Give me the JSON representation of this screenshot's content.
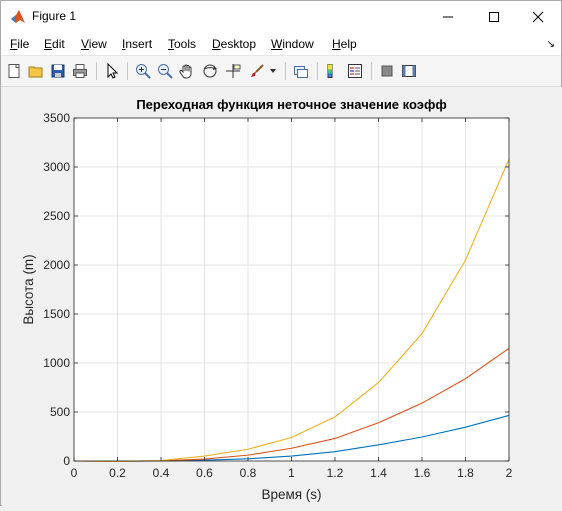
{
  "window": {
    "title": "Figure 1"
  },
  "menu": [
    {
      "pre": "",
      "u": "F",
      "post": "ile"
    },
    {
      "pre": "",
      "u": "E",
      "post": "dit"
    },
    {
      "pre": "",
      "u": "V",
      "post": "iew"
    },
    {
      "pre": "",
      "u": "I",
      "post": "nsert"
    },
    {
      "pre": "",
      "u": "T",
      "post": "ools"
    },
    {
      "pre": "",
      "u": "D",
      "post": "esktop"
    },
    {
      "pre": "",
      "u": "W",
      "post": "indow"
    },
    {
      "pre": "",
      "u": "H",
      "post": "elp"
    }
  ],
  "toolbar": [
    "new-figure-icon",
    "open-file-icon",
    "save-icon",
    "print-icon",
    "pointer-icon",
    "zoom-in-icon",
    "zoom-out-icon",
    "pan-hand-icon",
    "rotate-3d-icon",
    "data-cursor-icon",
    "brush-icon",
    "link-plot-icon",
    "colorbar-icon",
    "legend-icon",
    "hide-plot-tools-icon",
    "show-plot-tools-icon"
  ],
  "colors": {
    "series1": "#0072BD",
    "series2": "#D95319",
    "series3": "#EDB120",
    "grid": "#dcdcdc",
    "axes_bg": "#ffffff"
  },
  "chart_data": {
    "type": "line",
    "title": "Переходная функция неточное значение коэфф",
    "xlabel": "Время (s)",
    "ylabel": "Высота (m)",
    "xlim": [
      0,
      2
    ],
    "ylim": [
      0,
      3500
    ],
    "xticks": [
      "0",
      "0.2",
      "0.4",
      "0.6",
      "0.8",
      "1",
      "1.2",
      "1.4",
      "1.6",
      "1.8",
      "2"
    ],
    "yticks": [
      "0",
      "500",
      "1000",
      "1500",
      "2000",
      "2500",
      "3000",
      "3500"
    ],
    "grid": true,
    "series": [
      {
        "color": "#0072BD",
        "x": [
          0,
          0.2,
          0.4,
          0.6,
          0.8,
          1.0,
          1.2,
          1.4,
          1.6,
          1.8,
          2.0
        ],
        "y": [
          0,
          -2,
          0,
          8,
          22,
          50,
          95,
          165,
          245,
          345,
          465
        ]
      },
      {
        "color": "#D95319",
        "x": [
          0,
          0.2,
          0.4,
          0.6,
          0.8,
          1.0,
          1.2,
          1.4,
          1.6,
          1.8,
          2.0
        ],
        "y": [
          0,
          -3,
          2,
          20,
          60,
          130,
          230,
          390,
          590,
          840,
          1150
        ]
      },
      {
        "color": "#EDB120",
        "x": [
          0,
          0.2,
          0.4,
          0.6,
          0.8,
          1.0,
          1.2,
          1.4,
          1.6,
          1.8,
          2.0
        ],
        "y": [
          0,
          -5,
          5,
          50,
          120,
          240,
          450,
          800,
          1300,
          2050,
          3080
        ]
      }
    ]
  }
}
